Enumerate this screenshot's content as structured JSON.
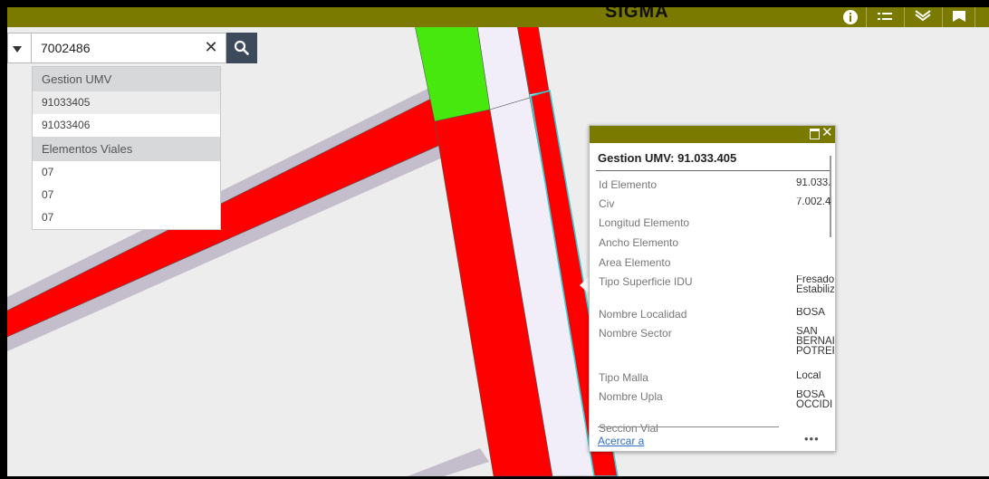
{
  "app": {
    "title": "SIGMA"
  },
  "toolbar": {
    "icons": [
      "info-icon",
      "legend-icon",
      "layers-icon",
      "bookmark-icon"
    ]
  },
  "search": {
    "value": "7002486",
    "clear_glyph": "✕"
  },
  "suggestions": {
    "groups": [
      {
        "label": "Gestion UMV",
        "items": [
          "91033405",
          "91033406"
        ]
      },
      {
        "label": "Elementos Viales",
        "items": [
          "07",
          "07",
          "07"
        ]
      }
    ]
  },
  "popup": {
    "title": "Gestion UMV: 91.033.405",
    "attributes": [
      {
        "label": "Id Elemento",
        "value": "91.033."
      },
      {
        "label": "Civ",
        "value": "7.002.4"
      },
      {
        "label": "Longitud Elemento",
        "value": ""
      },
      {
        "label": "Ancho Elemento",
        "value": ""
      },
      {
        "label": "Area Elemento",
        "value": ""
      },
      {
        "label": "Tipo Superficie IDU",
        "value": "Fresado\nEstabiliz"
      },
      {
        "label": "Nombre Localidad",
        "value": "BOSA"
      },
      {
        "label": "Nombre Sector",
        "value": "SAN\nBERNAI\nPOTREF"
      },
      {
        "label": "Tipo Malla",
        "value": "Local"
      },
      {
        "label": "Nombre Upla",
        "value": "BOSA\nOCCIDI"
      },
      {
        "label": "Seccion Vial",
        "value": ""
      }
    ],
    "zoom_label": "Acercar a",
    "more_label": "•••"
  },
  "colors": {
    "header": "#7a7a00",
    "road_red": "#ff0000",
    "road_green": "#46e80e",
    "road_lavender": "#f1eef9",
    "road_gray": "#c3bdcc",
    "highlight": "#35d0d8"
  }
}
